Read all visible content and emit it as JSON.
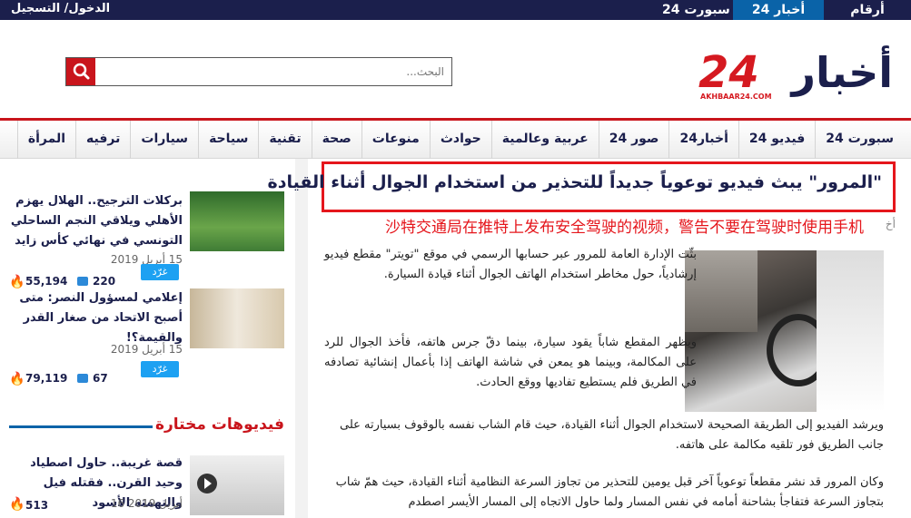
{
  "topbar": {
    "login": "الدخول/ التسجيل",
    "tabs": [
      "أرقام",
      "أخبار 24",
      "سبورت 24"
    ]
  },
  "logo": {
    "arabic": "أخبار",
    "num": "24",
    "sub": "AKHBAAR24.COM"
  },
  "search": {
    "placeholder": "البحث..."
  },
  "nav": {
    "items": [
      "سبورت 24",
      "فيديو 24",
      "أخبار24",
      "صور 24",
      "عربية وعالمية",
      "حوادث",
      "منوعات",
      "صحة",
      "تقنية",
      "سياحة",
      "سيارات",
      "ترفيه",
      "المرأة"
    ]
  },
  "article": {
    "title": "\"المرور\" يبث فيديو توعوياً جديداً للتحذير من استخدام الجوال أثناء القيادة",
    "annotation": "沙特交通局在推特上发布安全驾驶的视频，警告不要在驾驶时使用手机",
    "meta_frag": "أخ",
    "p1": "بثّت الإدارة العامة للمرور عبر حسابها الرسمي في موقع \"تويتر\" مقطع فيديو إرشادياً، حول مخاطر استخدام الهاتف الجوال أثناء قيادة السيارة.",
    "p2": "ويظهر المقطع شاباً يقود سيارة، بينما دقّ جرس هاتفه، فأخذ الجوال للرد على المكالمة، وبينما هو يمعن في شاشة الهاتف إذا بأعمال إنشائية تصادفه في الطريق فلم يستطيع تفاديها ووقع الحادث.",
    "p3": "ويرشد الفيديو إلى الطريقة الصحيحة لاستخدام الجوال أثناء القيادة، حيث قام الشاب نفسه بالوقوف بسيارته على جانب الطريق فور تلقيه مكالمة على هاتفه.",
    "p4": "وكان المرور قد نشر مقطعاً توعوياً آخر قبل يومين للتحذير من تجاوز السرعة النظامية أثناء القيادة، حيث همّ شاب بتجاوز السرعة فتفاجأ بشاحنة أمامه في نفس المسار ولما حاول الاتجاه إلى المسار الأيسر اصطدم"
  },
  "sidebar": {
    "items": [
      {
        "title": "بركلات الترجيح.. الهلال يهزم الأهلي ويلاقي النجم الساحلي التونسي في نهائي كأس زايد",
        "date": "15 أبريل 2019",
        "comments": "220",
        "views": "55,194",
        "tweet": "غرّد"
      },
      {
        "title": "إعلامي لمسؤول النصر: متى أصبح الاتحاد من صغار القدر والقيمة؟!",
        "date": "15 أبريل 2019",
        "comments": "67",
        "views": "79,119",
        "tweet": "غرّد"
      }
    ],
    "videos_label": "فيديوهات مختارة",
    "video": {
      "title": "قصة غريبة.. حاول اصطياد وحيد القرن.. فقتله فيل والتهمته الأسود",
      "date": "16 أبريل 2019",
      "views": "513"
    }
  },
  "colors": {
    "navy": "#1b1f4c",
    "red": "#c9151c",
    "blue": "#0a63a8"
  }
}
